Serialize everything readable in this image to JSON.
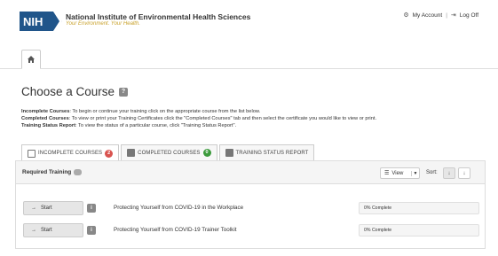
{
  "header": {
    "logo": "NIH",
    "org_name": "National Institute of Environmental Health Sciences",
    "tagline": "Your Environment. Your Health.",
    "my_account": "My Account",
    "separator": "|",
    "log_off": "Log Off"
  },
  "page": {
    "title": "Choose a Course",
    "help_glyph": "?"
  },
  "instructions": [
    {
      "label": "Incomplete Courses",
      "text": ": To begin or continue your training click on the appropriate course from the list below."
    },
    {
      "label": "Completed Courses",
      "text": ": To view or print your Training Certificates click the \"Completed Courses\" tab and then select the certificate you would like to view or print."
    },
    {
      "label": "Training Status Report",
      "text": ": To view the status of a particular course, click \"Training Status Report\"."
    }
  ],
  "tabs": [
    {
      "label": "INCOMPLETE COURSES",
      "count": "2",
      "count_color": "#d9534f"
    },
    {
      "label": "COMPLETED COURSES",
      "count": "0",
      "count_color": "#3c9a3c"
    },
    {
      "label": "TRAINING STATUS REPORT"
    }
  ],
  "panel": {
    "title": "Required Training",
    "count_glyph": "",
    "view_label": "View",
    "sort_label": "Sort:",
    "sort_asc_glyph": "↓",
    "sort_desc_glyph": "↓"
  },
  "courses": [
    {
      "start_label": "Start",
      "arrow": "→",
      "info_glyph": "i",
      "name": "Protecting Yourself from COVID-19 in the Workplace",
      "progress_label": "0% Complete",
      "progress": 0
    },
    {
      "start_label": "Start",
      "arrow": "→",
      "info_glyph": "i",
      "name": "Protecting Yourself from COVID-19 Trainer Toolkit",
      "progress_label": "0% Complete",
      "progress": 0
    }
  ],
  "colors": {
    "nih_blue": "#20558a",
    "tagline_gold": "#c8a12a",
    "progress_fill": "#5cb85c"
  }
}
